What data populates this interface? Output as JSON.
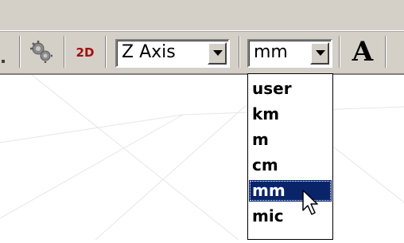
{
  "toolbar": {
    "view_2d_label": "2D",
    "axis_combo": {
      "value": "Z Axis"
    },
    "unit_combo": {
      "value": "mm"
    },
    "font_button_label": "A"
  },
  "unit_dropdown": {
    "options": [
      "user",
      "km",
      "m",
      "cm",
      "mm",
      "mic"
    ],
    "selected": "mm"
  },
  "icons": {
    "overflow": "toolbar-overflow-dot",
    "gear": "gear-icon",
    "dropdown_arrow": "chevron-down-icon",
    "cursor": "mouse-pointer-icon"
  },
  "colors": {
    "toolbar_bg": "#d4d0c8",
    "selection_bg": "#0a246a",
    "label_2d": "#a01010"
  }
}
